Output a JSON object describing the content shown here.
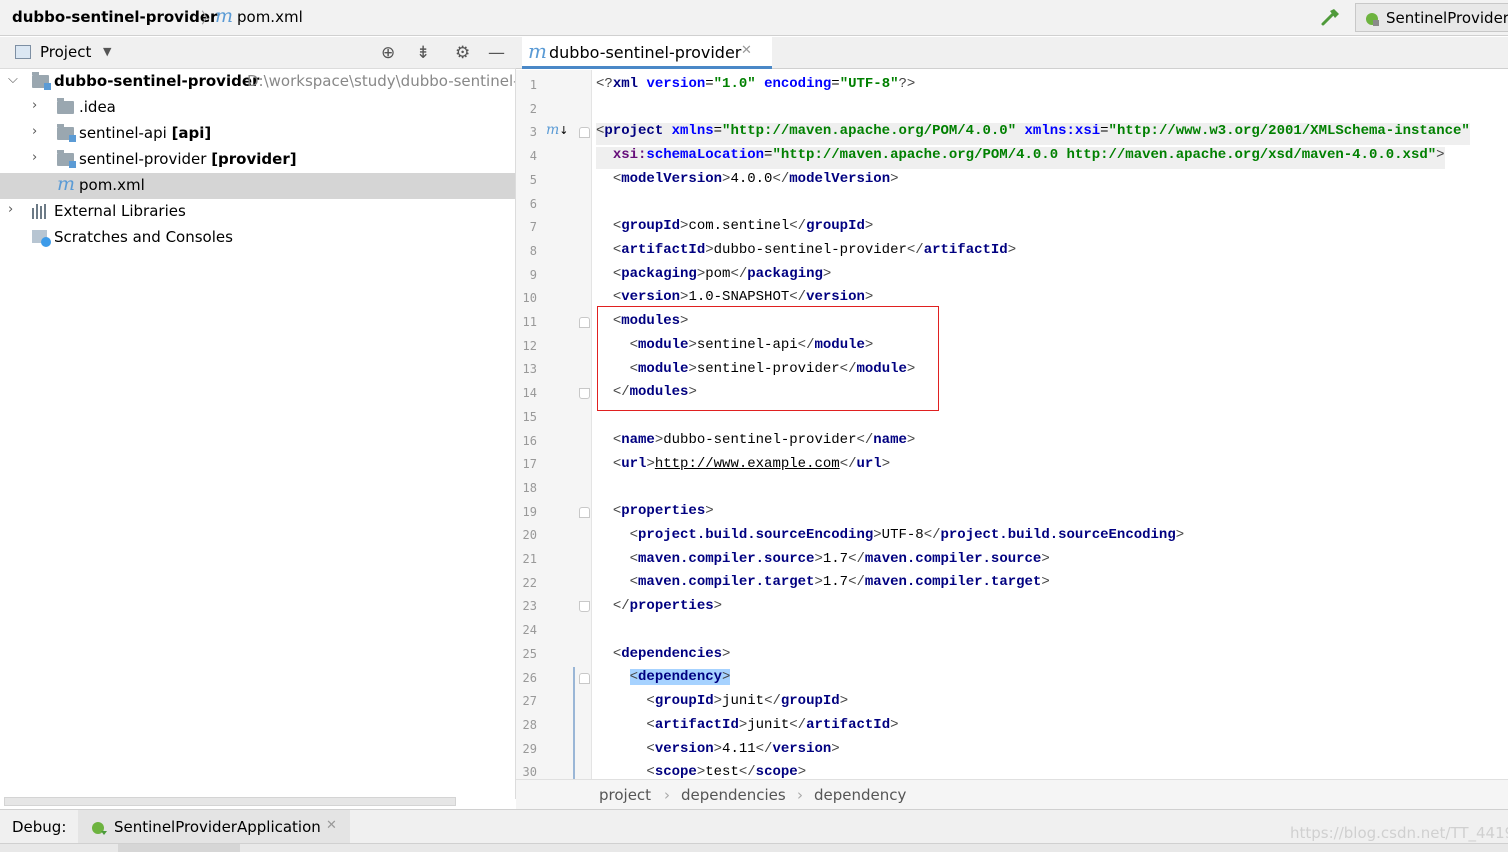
{
  "navbar": {
    "project_crumb": "dubbo-sentinel-provider",
    "file_crumb": "pom.xml",
    "run_config": "SentinelProvider"
  },
  "project_panel": {
    "title": "Project",
    "tree": [
      {
        "label": "dubbo-sentinel-provider",
        "path": "D:\\workspace\\study\\dubbo-sentinel-"
      },
      {
        "label": ".idea"
      },
      {
        "label": "sentinel-api ",
        "tag": "[api]"
      },
      {
        "label": "sentinel-provider ",
        "tag": "[provider]"
      },
      {
        "label": "pom.xml"
      },
      {
        "label": "External Libraries"
      },
      {
        "label": "Scratches and Consoles"
      }
    ]
  },
  "editor": {
    "tab_label": "dubbo-sentinel-provider",
    "line_numbers": [
      "1",
      "2",
      "3",
      "4",
      "5",
      "6",
      "7",
      "8",
      "9",
      "10",
      "11",
      "12",
      "13",
      "14",
      "15",
      "16",
      "17",
      "18",
      "19",
      "20",
      "21",
      "22",
      "23",
      "24",
      "25",
      "26",
      "27",
      "28",
      "29",
      "30"
    ],
    "code": {
      "xml_decl": {
        "version": "\"1.0\"",
        "encoding": "\"UTF-8\""
      },
      "project_tag": "project",
      "xmlns_value": "\"http://maven.apache.org/POM/4.0.0\"",
      "xsi_value": "\"http://www.w3.org/2001/XMLSchema-instance\"",
      "schema_location_value": "\"http://maven.apache.org/POM/4.0.0 http://maven.apache.org/xsd/maven-4.0.0.xsd\"",
      "model_version": "4.0.0",
      "group_id": "com.sentinel",
      "artifact_id": "dubbo-sentinel-provider",
      "packaging": "pom",
      "version": "1.0-SNAPSHOT",
      "modules": [
        "sentinel-api",
        "sentinel-provider"
      ],
      "name": "dubbo-sentinel-provider",
      "url": "http://www.example.com",
      "source_encoding": "UTF-8",
      "compiler_source": "1.7",
      "compiler_target": "1.7",
      "dep_group_id": "junit",
      "dep_artifact_id": "junit",
      "dep_version": "4.11",
      "dep_scope": "test"
    },
    "breadcrumbs": [
      "project",
      "dependencies",
      "dependency"
    ]
  },
  "debug": {
    "label": "Debug:",
    "tab": "SentinelProviderApplication"
  },
  "watermark": "https://blog.csdn.net/TT_4419",
  "colors": {
    "tag": "#000080",
    "attribute": "#0000ff",
    "value": "#008000",
    "highlight_box": "#e02020",
    "selected_tree_row": "#d5d5d5"
  }
}
